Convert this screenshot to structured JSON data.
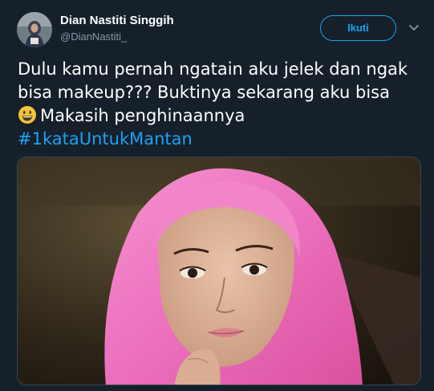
{
  "user": {
    "display_name": "Dian Nastiti Singgih",
    "handle": "@DianNastiti_"
  },
  "follow_button": {
    "label": "Ikuti"
  },
  "tweet": {
    "line1": "Dulu kamu pernah ngatain aku jelek dan ngak",
    "line2": "bisa makeup??? Buktinya sekarang aku bisa",
    "line3": "Makasih penghinaannya",
    "hashtag": "#1kataUntukMantan"
  },
  "icons": {
    "avatar": "profile-avatar",
    "more": "chevron-down-icon",
    "emoji": "grinning-face-emoji"
  },
  "colors": {
    "background": "#15202b",
    "accent": "#1da1f2",
    "secondary_text": "#8899a6",
    "hijab": "#f07cc4"
  }
}
